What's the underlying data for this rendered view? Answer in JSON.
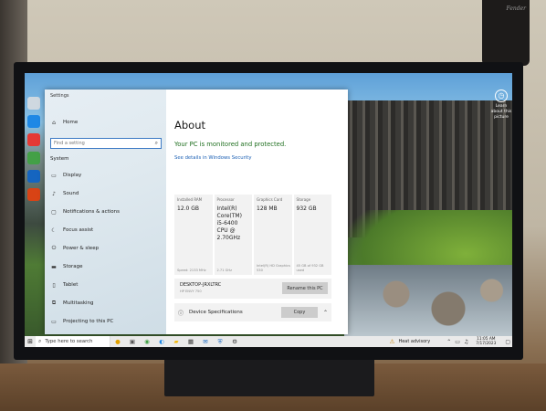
{
  "room": {
    "guitar_brand": "Fender"
  },
  "spotlight": {
    "label": "Learn about this picture"
  },
  "settings": {
    "window_title": "Settings",
    "sidebar": {
      "home": "Home",
      "search_placeholder": "Find a setting",
      "section": "System",
      "items": [
        {
          "label": "Display",
          "icon": "display-icon"
        },
        {
          "label": "Sound",
          "icon": "sound-icon"
        },
        {
          "label": "Notifications & actions",
          "icon": "notifications-icon"
        },
        {
          "label": "Focus assist",
          "icon": "focus-assist-icon"
        },
        {
          "label": "Power & sleep",
          "icon": "power-icon"
        },
        {
          "label": "Storage",
          "icon": "storage-icon"
        },
        {
          "label": "Tablet",
          "icon": "tablet-icon"
        },
        {
          "label": "Multitasking",
          "icon": "multitasking-icon"
        },
        {
          "label": "Projecting to this PC",
          "icon": "projecting-icon"
        }
      ]
    },
    "content": {
      "title": "About",
      "protected": "Your PC is monitored and protected.",
      "details_link": "See details in Windows Security",
      "cards": [
        {
          "label": "Installed RAM",
          "value": "12.0 GB",
          "foot": "Speed: 2133 MHz"
        },
        {
          "label": "Processor",
          "value": "Intel(R) Core(TM) i5-6400 CPU @ 2.70GHz",
          "foot": "2.71 GHz"
        },
        {
          "label": "Graphics Card",
          "value": "128 MB",
          "foot": "Intel(R) HD Graphics 530"
        },
        {
          "label": "Storage",
          "value": "932 GB",
          "foot": "45 GB of 932 GB used"
        }
      ],
      "device_name": "DESKTOP-JRXLTRC",
      "device_id": "HP ENVY 750",
      "rename_label": "Rename this PC",
      "spec_label": "Device Specifications",
      "copy_label": "Copy"
    }
  },
  "taskbar": {
    "search_placeholder": "Type here to search",
    "weather": "Heat advisory",
    "time": "11:05 AM",
    "date": "7/17/2023"
  }
}
